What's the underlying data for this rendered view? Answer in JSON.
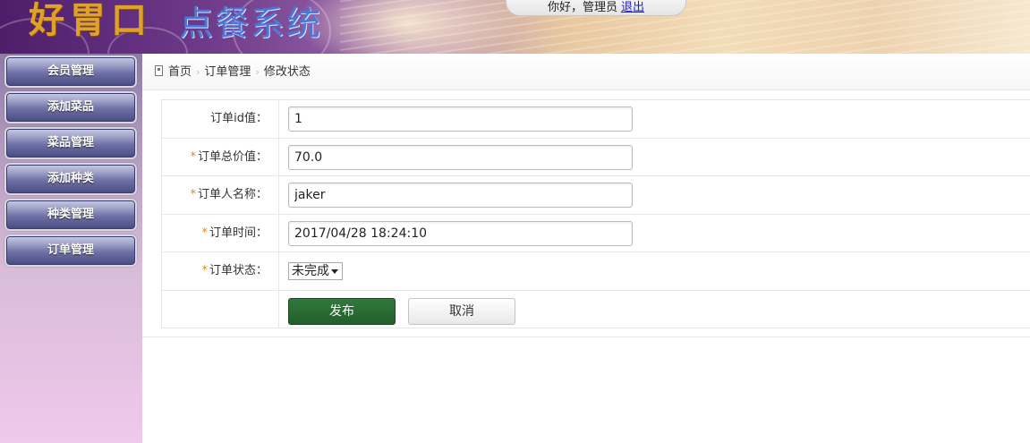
{
  "header": {
    "logo_left": "好胃口",
    "logo_right": "点餐系统",
    "greeting": "你好，管理员",
    "logout": "退出"
  },
  "sidebar": {
    "items": [
      {
        "label": "会员管理"
      },
      {
        "label": "添加菜品"
      },
      {
        "label": "菜品管理"
      },
      {
        "label": "添加种类"
      },
      {
        "label": "种类管理"
      },
      {
        "label": "订单管理"
      }
    ]
  },
  "breadcrumb": {
    "home": "首页",
    "section": "订单管理",
    "current": "修改状态"
  },
  "form": {
    "order_id": {
      "label": "订单id值：",
      "value": "1"
    },
    "total": {
      "required_mark": "*",
      "label": "订单总价值：",
      "value": "70.0"
    },
    "customer": {
      "required_mark": "*",
      "label": "订单人名称：",
      "value": "jaker"
    },
    "time": {
      "required_mark": "*",
      "label": "订单时间：",
      "value": "2017/04/28 18:24:10"
    },
    "status": {
      "required_mark": "*",
      "label": "订单状态：",
      "value": "未完成"
    },
    "submit_label": "发布",
    "cancel_label": "取消"
  },
  "colors": {
    "primary_button": "#2f7a3a",
    "required_mark": "#e08a1e",
    "sidebar_button": "#6e71a5"
  }
}
